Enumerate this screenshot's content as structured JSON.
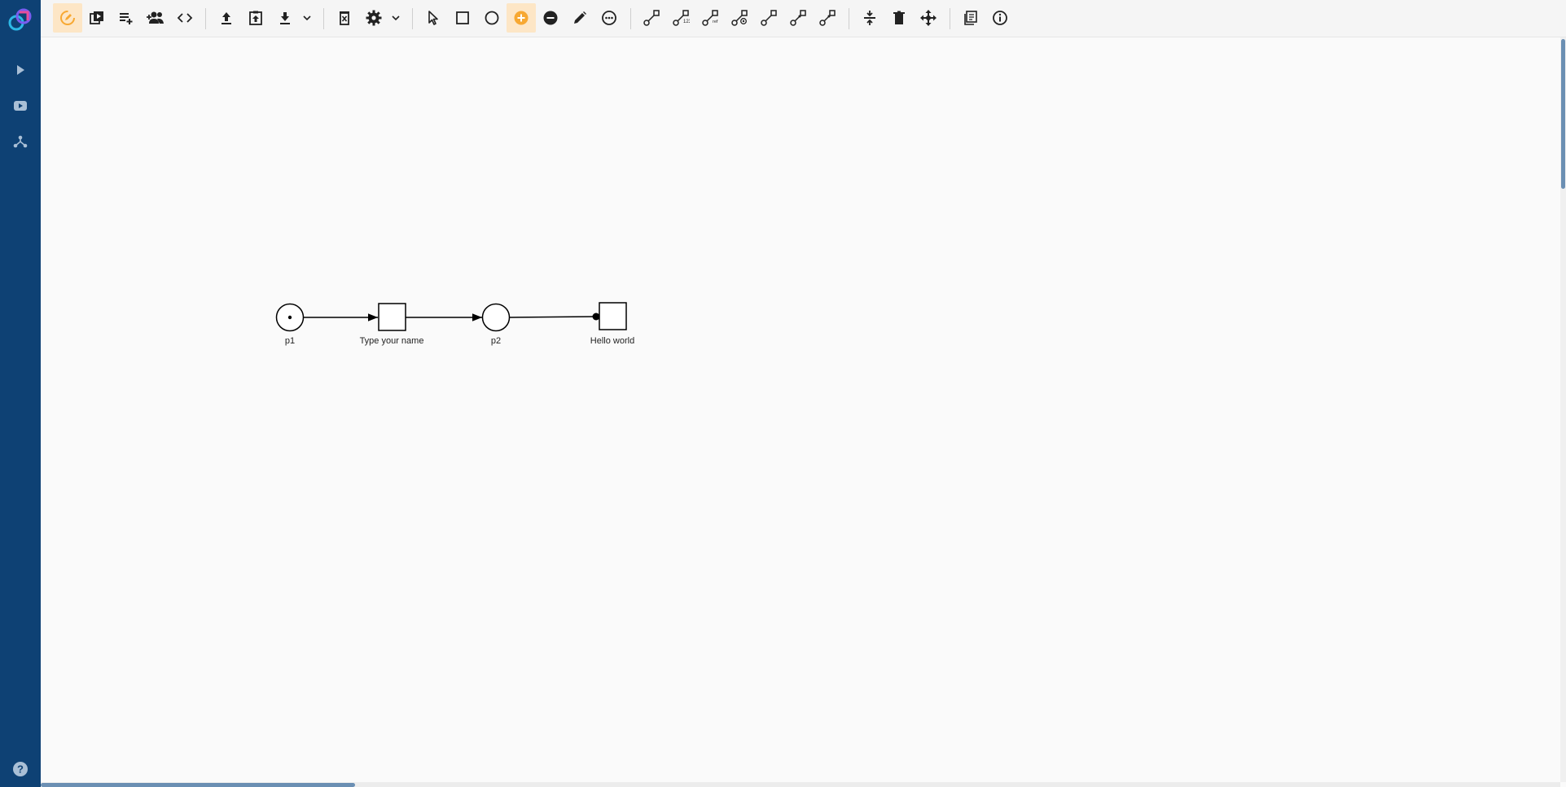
{
  "colors": {
    "sidebar_bg": "#0e4174",
    "accent": "#f7a832",
    "toolbar_bg": "#f5f5f5",
    "canvas_bg": "#fafafa"
  },
  "sidebar": {
    "items": [
      {
        "icon": "play-icon"
      },
      {
        "icon": "youtube-icon"
      },
      {
        "icon": "network-icon"
      }
    ],
    "help_icon": "help-icon"
  },
  "toolbar": {
    "tools": [
      "edit-circle-icon",
      "copy-play-icon",
      "playlist-add-icon",
      "group-add-icon",
      "code-icon",
      "upload-icon",
      "clipboard-upload-icon",
      "download-icon",
      "delete-file-icon",
      "gear-icon",
      "pointer-icon",
      "square-icon",
      "circle-icon",
      "add-circle-icon",
      "remove-circle-icon",
      "pencil-icon",
      "more-circle-icon",
      "arc-icon",
      "arc-numbered-icon",
      "arc-ref-icon",
      "arc-read-icon",
      "arc-reset-icon",
      "arc-inhibitor-icon",
      "arc-variable-icon",
      "vertical-align-icon",
      "trash-icon",
      "move-icon",
      "notes-icon",
      "info-icon"
    ]
  },
  "diagram": {
    "places": [
      {
        "label": "p1",
        "tokens": 1
      },
      {
        "label": "p2",
        "tokens": 0
      }
    ],
    "transitions": [
      {
        "label": "Type your name"
      },
      {
        "label": "Hello world"
      }
    ]
  }
}
